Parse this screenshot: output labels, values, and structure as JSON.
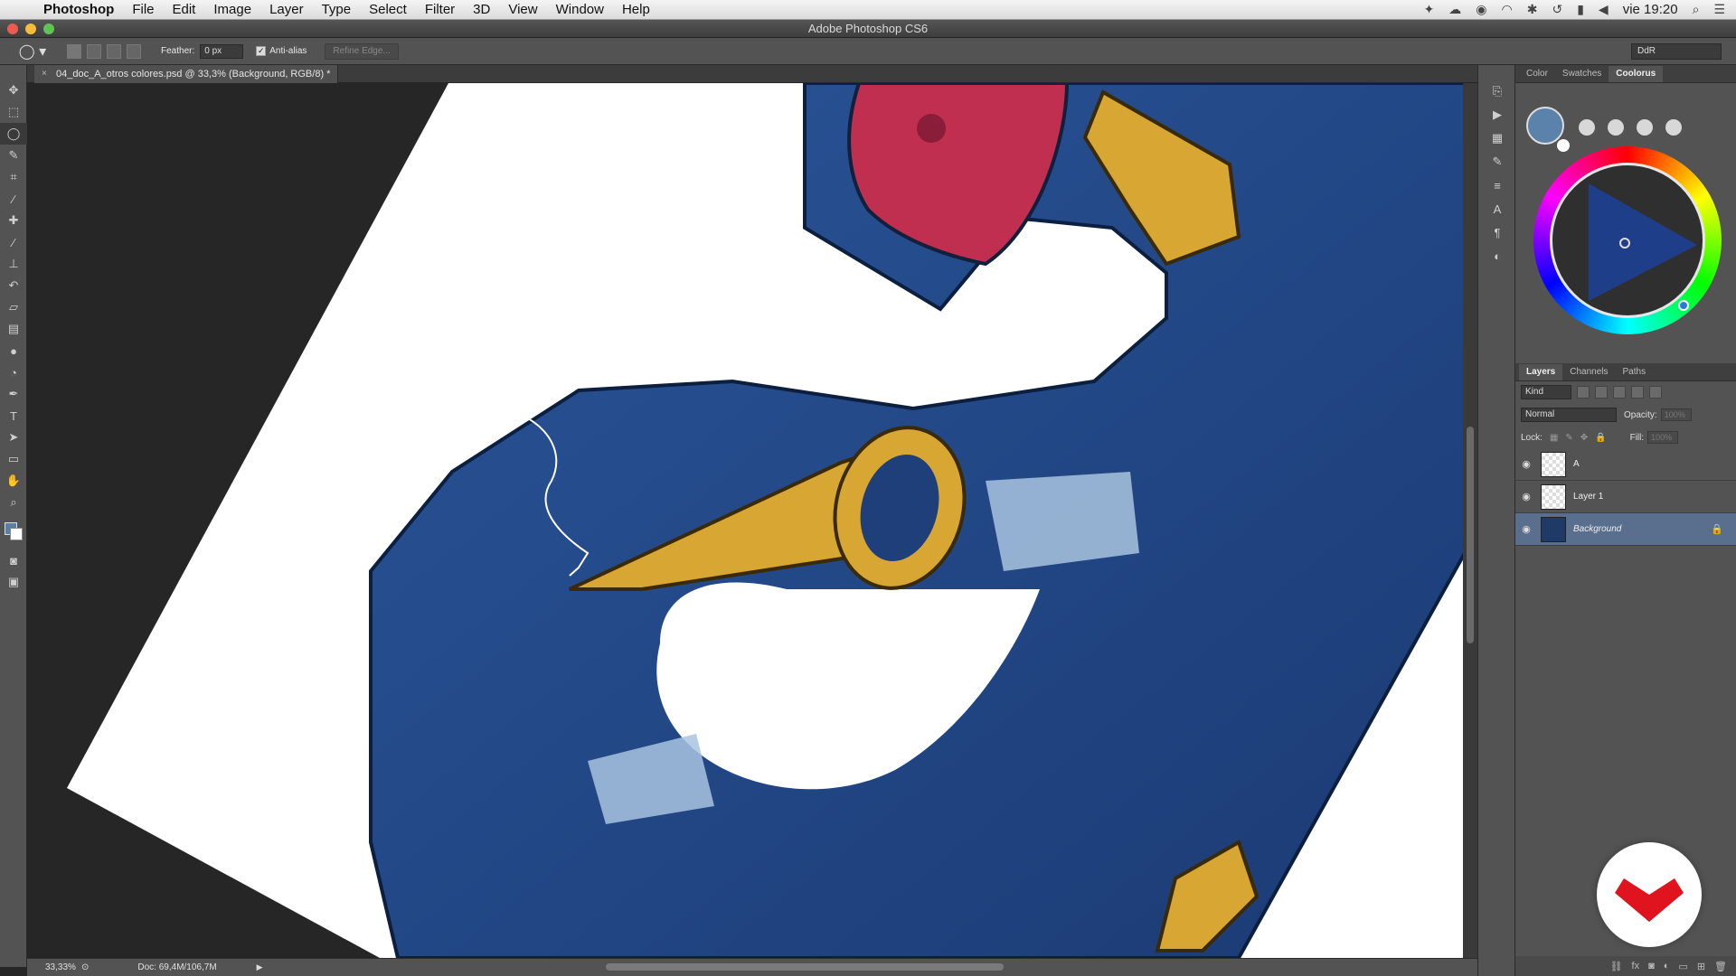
{
  "menubar": {
    "app_name": "Photoshop",
    "items": [
      "File",
      "Edit",
      "Image",
      "Layer",
      "Type",
      "Select",
      "Filter",
      "3D",
      "View",
      "Window",
      "Help"
    ],
    "clock": "vie 19:20"
  },
  "window": {
    "title": "Adobe Photoshop CS6"
  },
  "options_bar": {
    "feather_label": "Feather:",
    "feather_value": "0 px",
    "antialias_label": "Anti-alias",
    "antialias_checked": true,
    "refine_edge_label": "Refine Edge...",
    "workspace": "DdR"
  },
  "document": {
    "tab_label": "04_doc_A_otros colores.psd @ 33,3% (Background, RGB/8) *"
  },
  "status": {
    "zoom": "33,33%",
    "doc_size": "Doc: 69,4M/106,7M"
  },
  "color_panel": {
    "tabs": [
      "Color",
      "Swatches",
      "Coolorus"
    ],
    "active_tab": "Coolorus",
    "foreground_color": "#5a82ab"
  },
  "layers_panel": {
    "tabs": [
      "Layers",
      "Channels",
      "Paths"
    ],
    "active_tab": "Layers",
    "kind_label": "Kind",
    "blend_mode": "Normal",
    "opacity_label": "Opacity:",
    "opacity_value": "100%",
    "lock_label": "Lock:",
    "fill_label": "Fill:",
    "fill_value": "100%",
    "layers": [
      {
        "name": "A",
        "visible": true,
        "selected": false
      },
      {
        "name": "Layer 1",
        "visible": true,
        "selected": false
      },
      {
        "name": "Background",
        "visible": true,
        "selected": true,
        "locked": true
      }
    ]
  },
  "colors": {
    "accent_selection": "#5a6f8e",
    "brand_red": "#e0141e"
  }
}
